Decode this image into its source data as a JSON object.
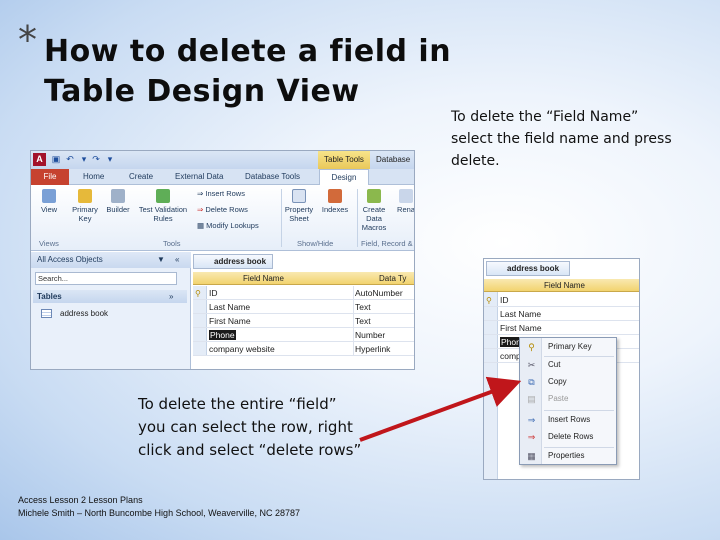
{
  "slide": {
    "bullet": "*",
    "title": "How to delete a field in Table Design View",
    "note_right": "To delete the “Field Name” select the field name and press delete.",
    "note_left": "To delete the entire “field” you can select the row, right click and select “delete rows”",
    "footer_line1": "Access Lesson 2 Lesson Plans",
    "footer_line2": "Michele Smith – North Buncombe High School, Weaverville, NC 28787",
    "arrow_color": "#c0161b"
  },
  "access": {
    "app_icon": "A",
    "context_tab": "Table Tools",
    "db_title": "Database",
    "tabs": [
      "File",
      "Home",
      "Create",
      "External Data",
      "Database Tools",
      "Design"
    ],
    "ribbon": {
      "view": "View",
      "primary_key": "Primary Key",
      "builder": "Builder",
      "test_validation_rules": "Test Validation Rules",
      "insert_rows": "Insert Rows",
      "delete_rows": "Delete Rows",
      "modify_lookups": "Modify Lookups",
      "property_sheet": "Property Sheet",
      "indexes": "Indexes",
      "create_data_macros": "Create Data Macros",
      "rename": "Rena"
    },
    "groups": [
      "Views",
      "Tools",
      "Show/Hide",
      "Field, Record &"
    ],
    "nav": {
      "header": "All Access Objects",
      "search_placeholder": "Search...",
      "group": "Tables",
      "item": "address book"
    },
    "table": {
      "tab_name": "address book",
      "col_field_name": "Field Name",
      "col_data_type": "Data Ty",
      "rows": [
        {
          "name": "ID",
          "type": "AutoNumber"
        },
        {
          "name": "Last Name",
          "type": "Text"
        },
        {
          "name": "First Name",
          "type": "Text"
        },
        {
          "name": "Phone",
          "type": "Number"
        },
        {
          "name": "company website",
          "type": "Hyperlink"
        }
      ]
    }
  },
  "access2": {
    "tab_name": "address book",
    "col_field_name": "Field Name",
    "rows": [
      "ID",
      "Last Name",
      "First Name",
      "Phon",
      "comp"
    ],
    "context_menu": [
      {
        "label": "Primary Key",
        "icon": "key-icon",
        "disabled": false
      },
      {
        "label": "Cut",
        "icon": "scissors-icon",
        "disabled": false
      },
      {
        "label": "Copy",
        "icon": "copy-icon",
        "disabled": false
      },
      {
        "label": "Paste",
        "icon": "paste-icon",
        "disabled": true
      },
      {
        "label": "Insert Rows",
        "icon": "insert-rows-icon",
        "disabled": false
      },
      {
        "label": "Delete Rows",
        "icon": "delete-rows-icon",
        "disabled": false
      },
      {
        "label": "Properties",
        "icon": "properties-icon",
        "disabled": false
      }
    ]
  }
}
